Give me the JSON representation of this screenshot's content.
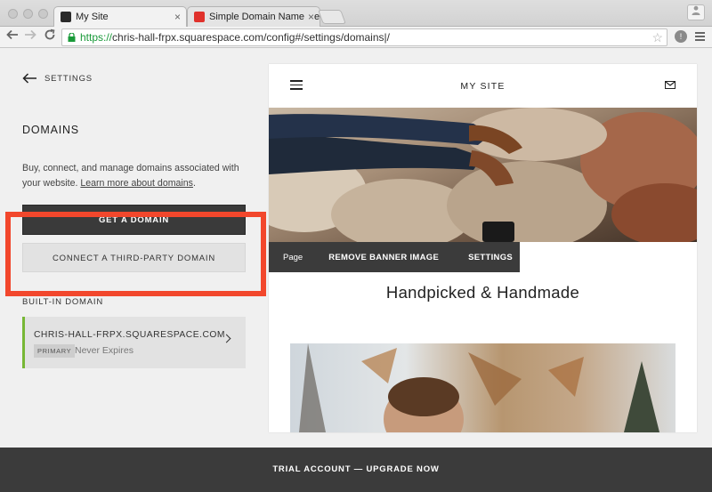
{
  "browser": {
    "tabs": [
      {
        "title": "My Site",
        "active": true
      },
      {
        "title": "Simple Domain Name Regi",
        "active": false
      }
    ],
    "close_glyph": "×",
    "url": {
      "scheme": "https://",
      "rest": "chris-hall-frpx.squarespace.com/config#/settings/domains|/"
    }
  },
  "left_panel": {
    "back_label": "SETTINGS",
    "heading": "DOMAINS",
    "description": "Buy, connect, and manage domains associated with your website. ",
    "learn_more": "Learn more about domains",
    "description_end": ".",
    "get_domain_label": "GET A DOMAIN",
    "connect_label": "CONNECT A THIRD-PARTY DOMAIN",
    "builtin_label": "BUILT-IN DOMAIN",
    "builtin_domain": {
      "name": "CHRIS-HALL-FRPX.SQUARESPACE.COM",
      "badge": "PRIMARY",
      "expiry": "Never Expires"
    }
  },
  "preview": {
    "site_title": "MY SITE",
    "overlay": {
      "page": "Page",
      "remove_banner": "REMOVE BANNER IMAGE",
      "settings": "SETTINGS"
    },
    "page_heading": "Handpicked & Handmade"
  },
  "trial_bar": {
    "text": "TRIAL ACCOUNT — UPGRADE NOW"
  },
  "colors": {
    "highlight_box": "#f2472c",
    "primary_border": "#77b735",
    "trial_bar": "#3b3b3b",
    "url_scheme": "#1a9a3a"
  },
  "icons": [
    "back-arrow-icon",
    "hamburger-icon",
    "mail-icon",
    "chevron-right-icon",
    "lock-icon",
    "star-icon",
    "browser-menu-icon"
  ]
}
